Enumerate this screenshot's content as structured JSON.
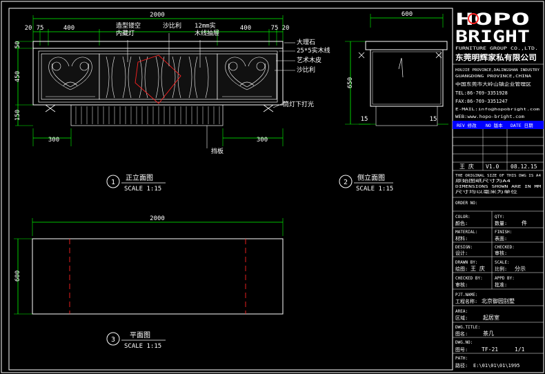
{
  "drawing": {
    "front_view": {
      "dims_top": [
        "2000",
        "20",
        "75",
        "400",
        "400",
        "75",
        "20"
      ],
      "dims_left": [
        "50",
        "450",
        "150"
      ],
      "dims_bottom": [
        "300",
        "300"
      ],
      "callouts": [
        "造型镂空",
        "内藏灯",
        "沙比利",
        "12mm实",
        "木线抽屉",
        "大理石",
        "25*5实木线",
        "艺术木皮",
        "沙比利",
        "筒灯下打光",
        "挡板"
      ],
      "title_num": "1",
      "title": "正立面图",
      "scale": "SCALE 1:15"
    },
    "side_view": {
      "dims": [
        "600",
        "650",
        "15",
        "15"
      ],
      "title_num": "2",
      "title": "侧立面图",
      "scale": "SCALE 1:15"
    },
    "plan_view": {
      "dims": [
        "2000",
        "600"
      ],
      "title_num": "3",
      "title": "平面图",
      "scale": "SCALE 1:15"
    }
  },
  "title_block": {
    "logo_top": "HOPO",
    "logo_bottom": "BRIGHT",
    "company_en": "FURNITURE GROUP CO.,LTD.",
    "company_cn": "东莞明辉家私有限公司",
    "address_lines": [
      "HOUJIE PROVINCE,DALINGSHAN INDUSTRY",
      "GUANGDONG PROVINCE,CHINA",
      "中国东莞市大岭山镇企业管理区",
      "TEL:86-769-3351928",
      "FAX:86-769-3351247",
      "E-MAIL:info@hopobright.com",
      "WEB:www.hopo-bright.com"
    ],
    "rev_header": [
      "REV 修改",
      "NO 版本",
      "DATE 日期"
    ],
    "rev_row": [
      "王 庆",
      "V1.0",
      "08.12.15"
    ],
    "notes": [
      "THE ORIGINAL SIZE OF THIS DWG IS A4",
      "原始图纸尺寸为A4",
      "DIMENSIONS SHOWN ARE IN MM",
      "尺寸均以毫米为单位"
    ],
    "fields": [
      {
        "en": "ORDER NO:",
        "cn": "",
        "val": ""
      },
      {
        "en": "COLOR:",
        "cn": "颜色:",
        "val": "",
        "en2": "QTY:",
        "cn2": "数量:",
        "val2": "件"
      },
      {
        "en": "MATERIAL:",
        "cn": "材料:",
        "val": "",
        "en2": "FINISH:",
        "cn2": "表面:",
        "val2": ""
      },
      {
        "en": "DESIGN:",
        "cn": "设计:",
        "val": "",
        "en2": "CHECKED:",
        "cn2": "审核:",
        "val2": ""
      },
      {
        "en": "DRAWN BY:",
        "cn": "绘图:",
        "val": "王 庆",
        "en2": "SCALE:",
        "cn2": "比例:",
        "val2": "分示"
      },
      {
        "en": "CHECKED BY:",
        "cn": "审核:",
        "val": "",
        "en2": "APPD BY:",
        "cn2": "批准:",
        "val2": ""
      },
      {
        "en": "PJT.NAME:",
        "cn": "工程名称:",
        "val": "北京御园别墅"
      },
      {
        "en": "AREA:",
        "cn": "区域:",
        "val": "起居室"
      },
      {
        "en": "DWG.TITLE:",
        "cn": "图名:",
        "val": "茶几"
      },
      {
        "en": "DWG.NO:",
        "cn": "图号:",
        "val": "TF-21",
        "val2": "1/1"
      },
      {
        "en": "PATH:",
        "cn": "路径:",
        "val": "E:\\01\\01\\01\\1995"
      }
    ]
  },
  "colors": {
    "bg": "#000000",
    "line": "#ffffff",
    "dim": "#00ff00",
    "accent": "#ff2020",
    "title_bar": "#0000ff"
  }
}
